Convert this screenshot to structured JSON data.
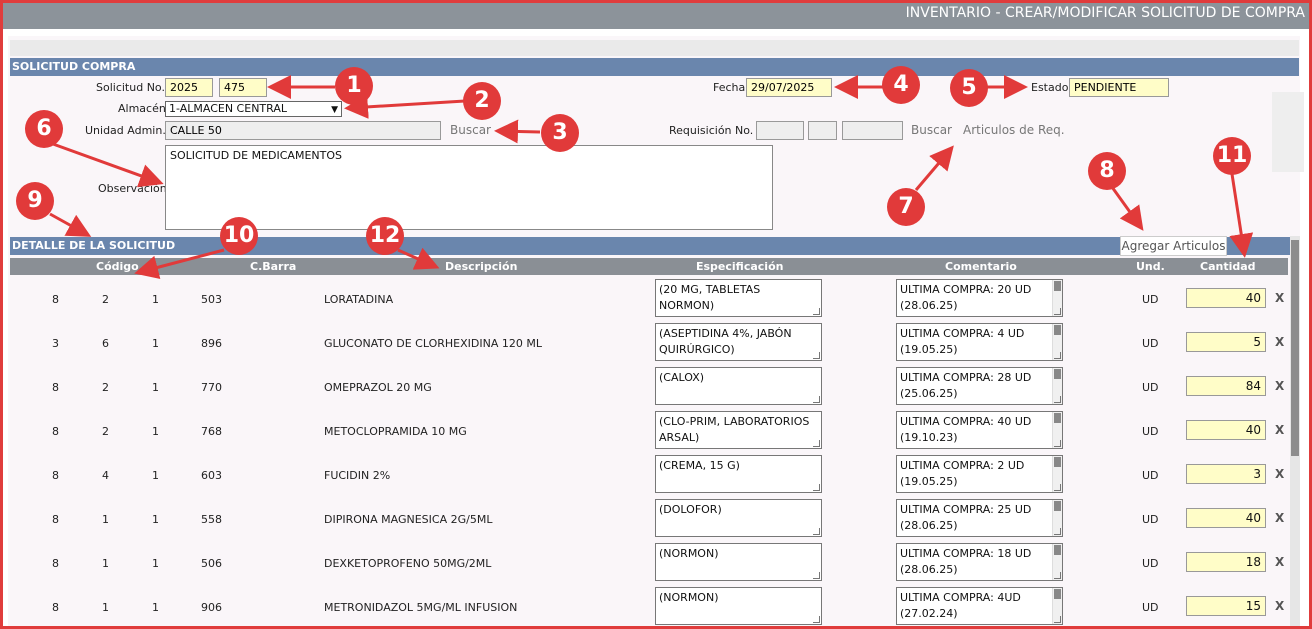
{
  "window": {
    "title": "INVENTARIO - CREAR/MODIFICAR SOLICITUD DE COMPRA"
  },
  "form": {
    "section_title": "SOLICITUD COMPRA",
    "solicitud_label": "Solicitud No.",
    "solicitud_year": "2025",
    "solicitud_num": "475",
    "almacen_label": "Almacén",
    "almacen_value": "1-ALMACEN CENTRAL",
    "unidad_label": "Unidad Admin.",
    "unidad_value": "CALLE 50",
    "buscar_label": "Buscar",
    "observacion_label": "Observación",
    "observacion_value": "SOLICITUD DE MEDICAMENTOS",
    "fecha_label": "Fecha",
    "fecha_value": "29/07/2025",
    "estado_label": "Estado",
    "estado_value": "PENDIENTE",
    "requisicion_label": "Requisición No.",
    "buscar2_label": "Buscar",
    "articulos_req_label": "Articulos de Req."
  },
  "detail": {
    "section_title": "DETALLE DE LA SOLICITUD",
    "agregar_label": "Agregar Articulos",
    "columns": {
      "codigo": "Código",
      "cbarra": "C.Barra",
      "descripcion": "Descripción",
      "especificacion": "Especificación",
      "comentario": "Comentario",
      "und": "Und.",
      "cantidad": "Cantidad"
    },
    "delete_symbol": "X",
    "rows": [
      {
        "c1": "8",
        "c2": "2",
        "c3": "1",
        "cbarra": "503",
        "descripcion": "LORATADINA",
        "especificacion": "(20 MG, TABLETAS NORMON)",
        "comentario": "ULTIMA COMPRA: 20 UD (28.06.25)",
        "und": "UD",
        "cantidad": "40"
      },
      {
        "c1": "3",
        "c2": "6",
        "c3": "1",
        "cbarra": "896",
        "descripcion": "GLUCONATO DE CLORHEXIDINA 120 ML",
        "especificacion": "(ASEPTIDINA 4%, JABÓN QUIRÚRGICO)",
        "comentario": "ULTIMA COMPRA: 4 UD (19.05.25)",
        "und": "UD",
        "cantidad": "5"
      },
      {
        "c1": "8",
        "c2": "2",
        "c3": "1",
        "cbarra": "770",
        "descripcion": "OMEPRAZOL 20 MG",
        "especificacion": "(CALOX)",
        "comentario": "ULTIMA COMPRA: 28 UD (25.06.25)",
        "und": "UD",
        "cantidad": "84"
      },
      {
        "c1": "8",
        "c2": "2",
        "c3": "1",
        "cbarra": "768",
        "descripcion": "METOCLOPRAMIDA 10 MG",
        "especificacion": "(CLO-PRIM, LABORATORIOS ARSAL)",
        "comentario": "ULTIMA COMPRA: 40 UD (19.10.23)",
        "und": "UD",
        "cantidad": "40"
      },
      {
        "c1": "8",
        "c2": "4",
        "c3": "1",
        "cbarra": "603",
        "descripcion": "FUCIDIN 2%",
        "especificacion": "(CREMA, 15 G)",
        "comentario": "ULTIMA COMPRA: 2 UD (19.05.25)",
        "und": "UD",
        "cantidad": "3"
      },
      {
        "c1": "8",
        "c2": "1",
        "c3": "1",
        "cbarra": "558",
        "descripcion": "DIPIRONA MAGNESICA 2G/5ML",
        "especificacion": "(DOLOFOR)",
        "comentario": "ULTIMA COMPRA: 25 UD (28.06.25)",
        "und": "UD",
        "cantidad": "40"
      },
      {
        "c1": "8",
        "c2": "1",
        "c3": "1",
        "cbarra": "506",
        "descripcion": "DEXKETOPROFENO 50MG/2ML",
        "especificacion": "(NORMON)",
        "comentario": "ULTIMA COMPRA: 18 UD (28.06.25)",
        "und": "UD",
        "cantidad": "18"
      },
      {
        "c1": "8",
        "c2": "1",
        "c3": "1",
        "cbarra": "906",
        "descripcion": "METRONIDAZOL 5MG/ML INFUSION",
        "especificacion": "(NORMON)",
        "comentario": "ULTIMA COMPRA: 4UD (27.02.24)",
        "und": "UD",
        "cantidad": "15"
      }
    ]
  },
  "annotations": [
    "1",
    "2",
    "3",
    "4",
    "5",
    "6",
    "7",
    "8",
    "9",
    "10",
    "11",
    "12"
  ],
  "colors": {
    "frame": "#e03c3c",
    "section_bar": "#6a86ad",
    "header_bar": "#8a8f95",
    "input_yellow": "#fffdc8",
    "annotation": "#e13a3a"
  }
}
